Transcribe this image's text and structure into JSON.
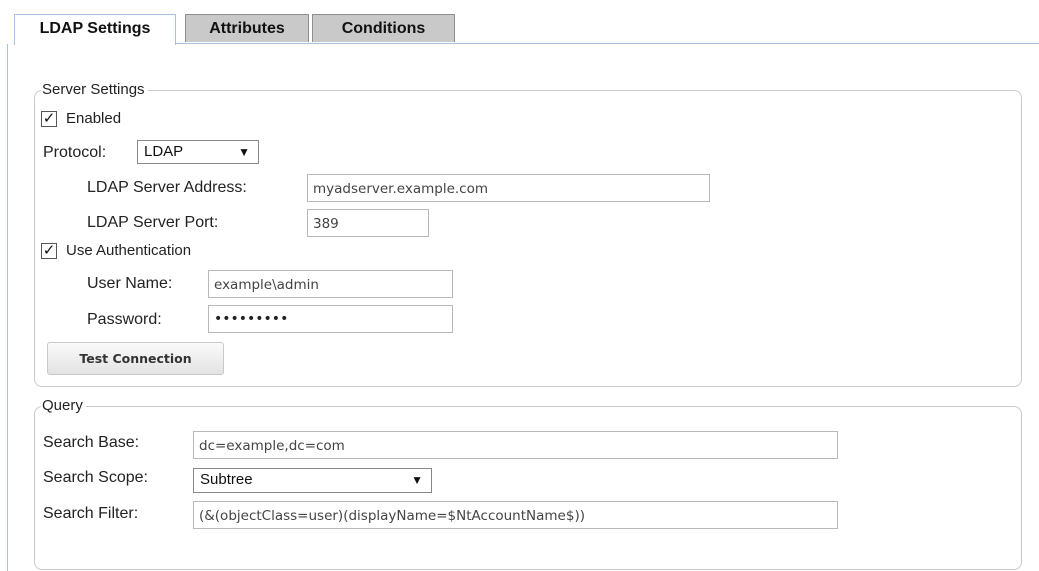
{
  "tabs": [
    {
      "label": "LDAP Settings",
      "active": true
    },
    {
      "label": "Attributes",
      "active": false
    },
    {
      "label": "Conditions",
      "active": false
    }
  ],
  "server_settings": {
    "legend": "Server Settings",
    "enabled": {
      "label": "Enabled",
      "checked": true
    },
    "protocol": {
      "label": "Protocol:",
      "value": "LDAP"
    },
    "server_address": {
      "label": "LDAP Server Address:",
      "value": "myadserver.example.com"
    },
    "server_port": {
      "label": "LDAP Server Port:",
      "value": "389"
    },
    "use_auth": {
      "label": "Use Authentication",
      "checked": true
    },
    "user_name": {
      "label": "User Name:",
      "value": "example\\admin"
    },
    "password": {
      "label": "Password:",
      "value": "•••••••••"
    },
    "test_button": "Test Connection"
  },
  "query": {
    "legend": "Query",
    "search_base": {
      "label": "Search Base:",
      "value": "dc=example,dc=com"
    },
    "search_scope": {
      "label": "Search Scope:",
      "value": "Subtree"
    },
    "search_filter": {
      "label": "Search Filter:",
      "value": "(&(objectClass=user)(displayName=$NtAccountName$))"
    }
  },
  "icons": {
    "checkmark": "✓",
    "dropdown": "▼"
  }
}
